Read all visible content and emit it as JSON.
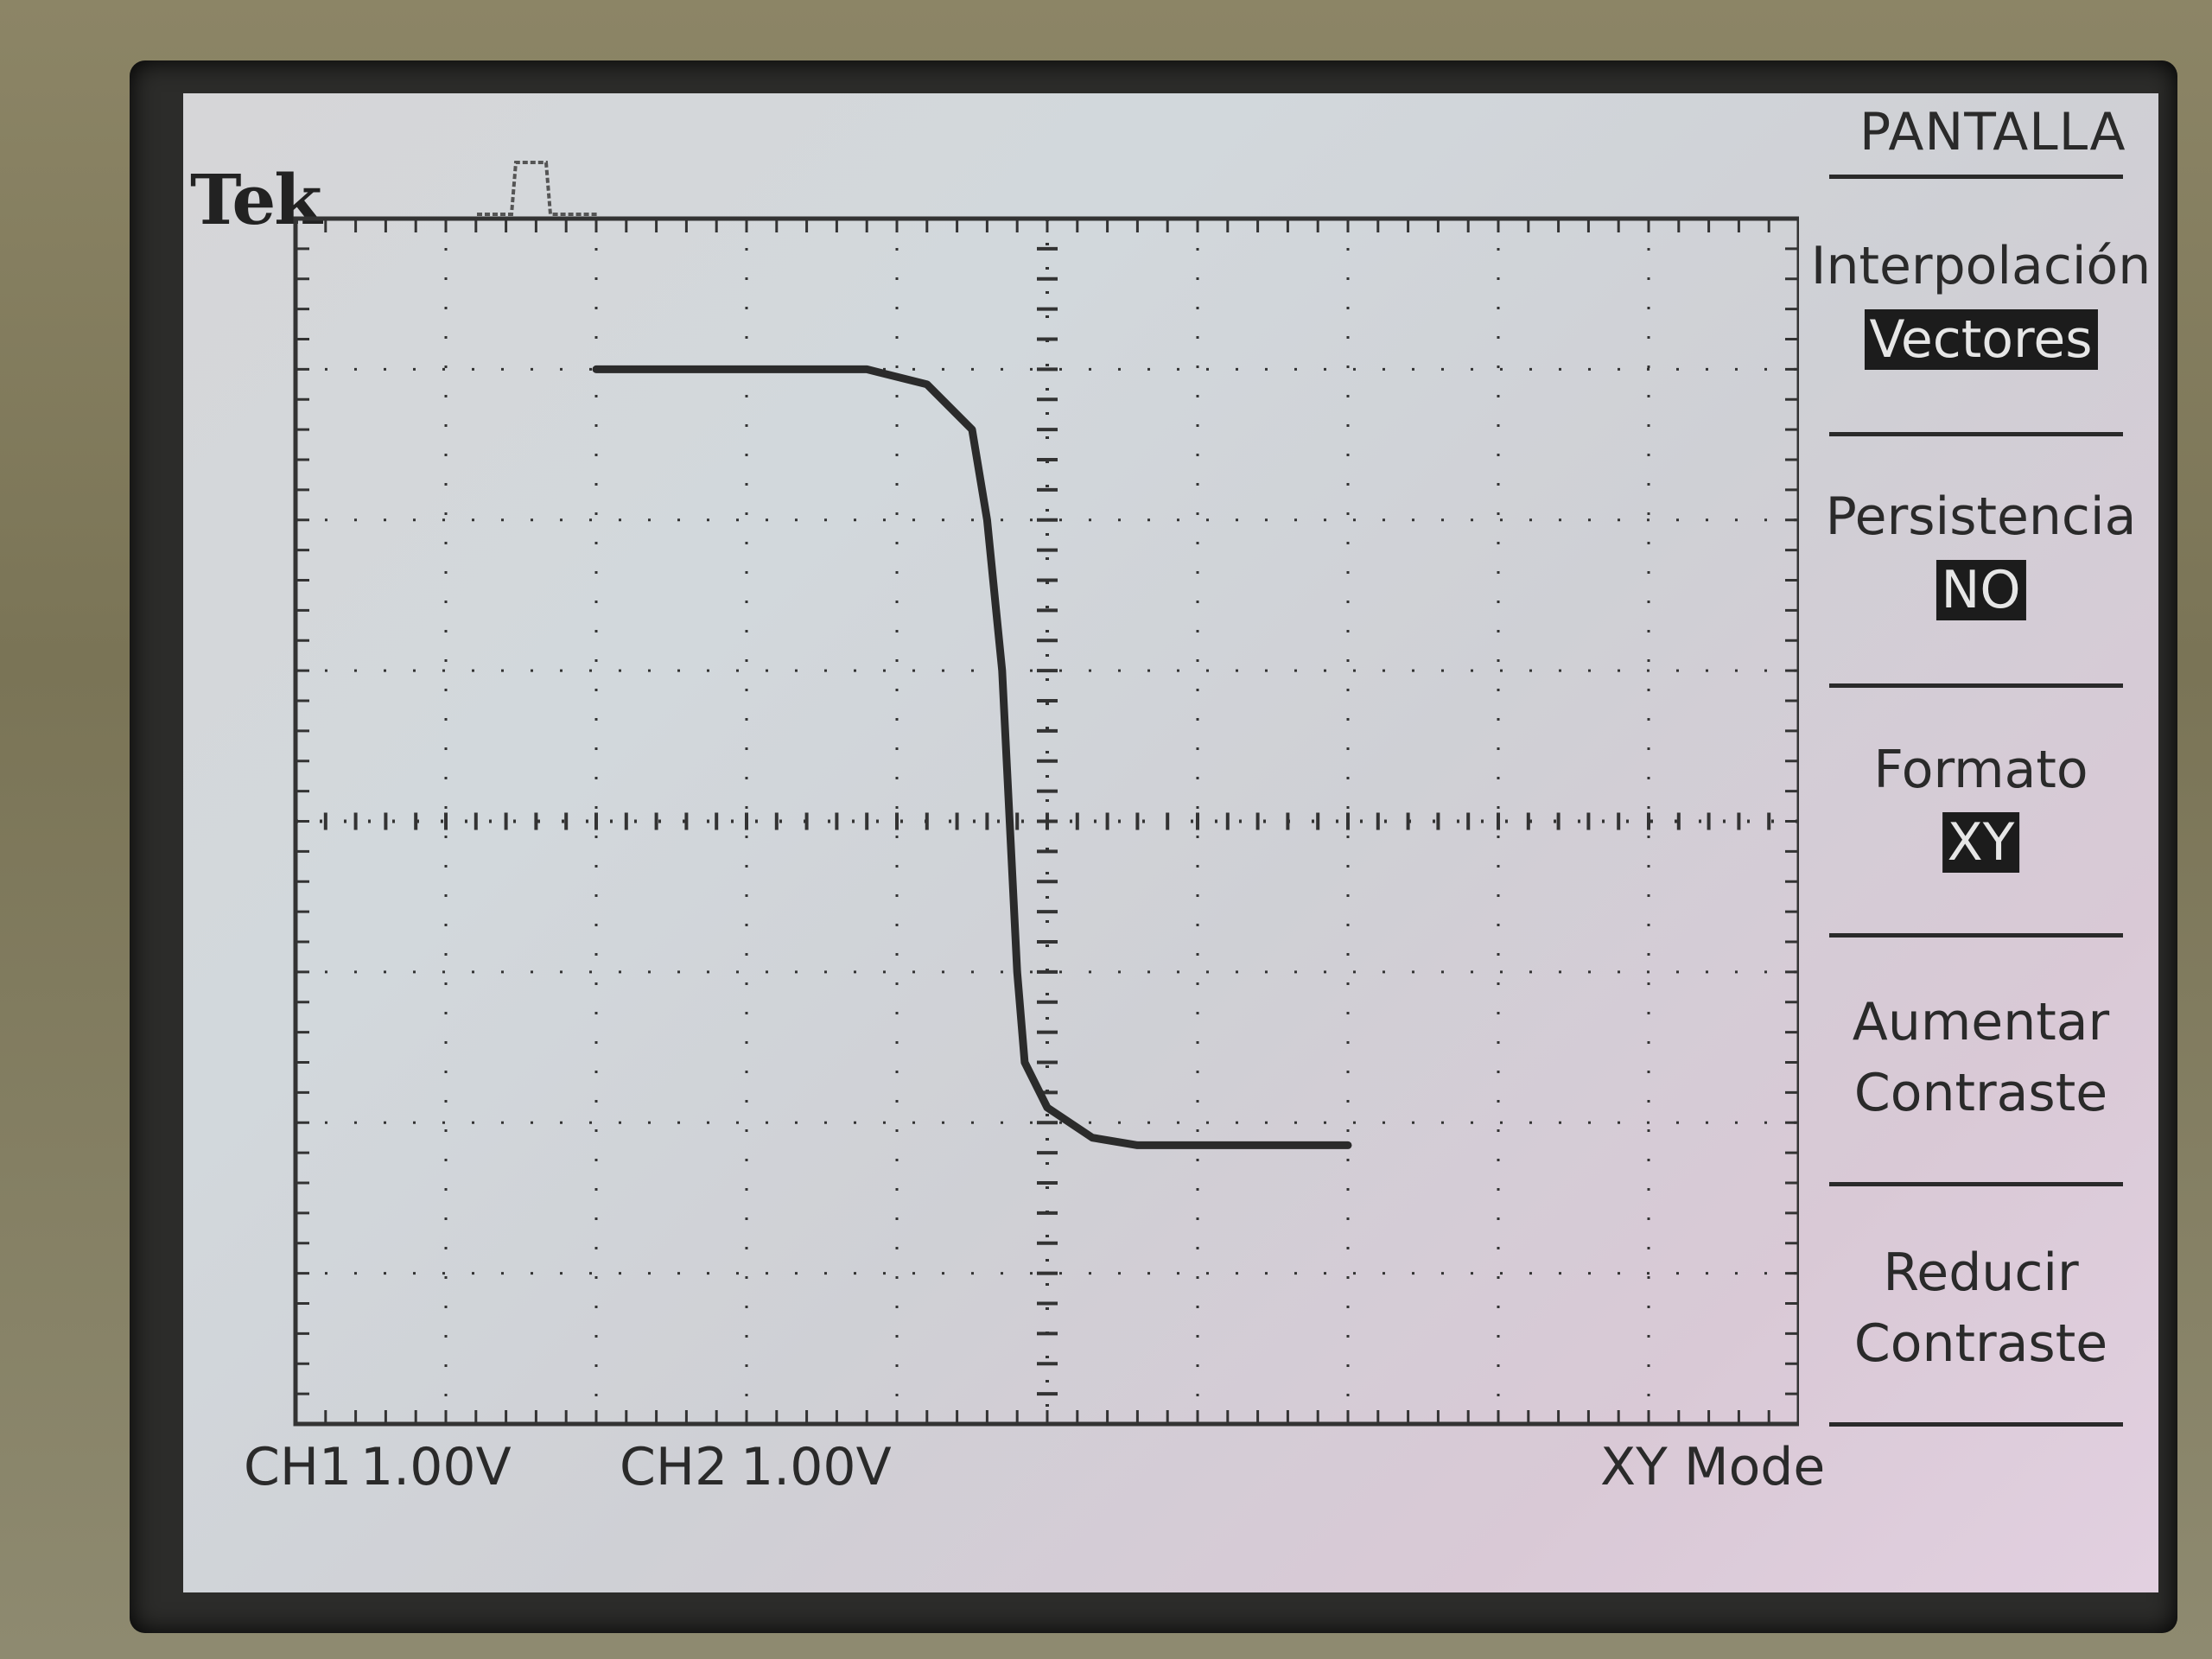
{
  "brand": "Tek",
  "channels": {
    "ch1": {
      "label": "CH1",
      "scale": "1.00V"
    },
    "ch2": {
      "label": "CH2",
      "scale": "1.00V"
    },
    "mode": "XY Mode"
  },
  "menu": {
    "title": "PANTALLA",
    "items": [
      {
        "label": "Interpolación",
        "value": "Vectores"
      },
      {
        "label": "Persistencia",
        "value": "NO"
      },
      {
        "label": "Formato",
        "value": "XY"
      },
      {
        "label_line1": "Aumentar",
        "label_line2": "Contraste"
      },
      {
        "label_line1": "Reducir",
        "label_line2": "Contraste"
      }
    ]
  },
  "trace": {
    "description_points_div": [
      [
        -3,
        3
      ],
      [
        -1.2,
        3
      ],
      [
        -0.8,
        2.9
      ],
      [
        -0.5,
        2.6
      ],
      [
        -0.4,
        2.0
      ],
      [
        -0.3,
        1.0
      ],
      [
        -0.25,
        0
      ],
      [
        -0.2,
        -1.0
      ],
      [
        -0.15,
        -1.6
      ],
      [
        0.0,
        -1.9
      ],
      [
        0.3,
        -2.1
      ],
      [
        0.6,
        -2.15
      ],
      [
        2.0,
        -2.15
      ]
    ]
  },
  "colors": {
    "trace": "#2b2b2b",
    "screen": "#d4d6da",
    "grid": "#333333"
  }
}
